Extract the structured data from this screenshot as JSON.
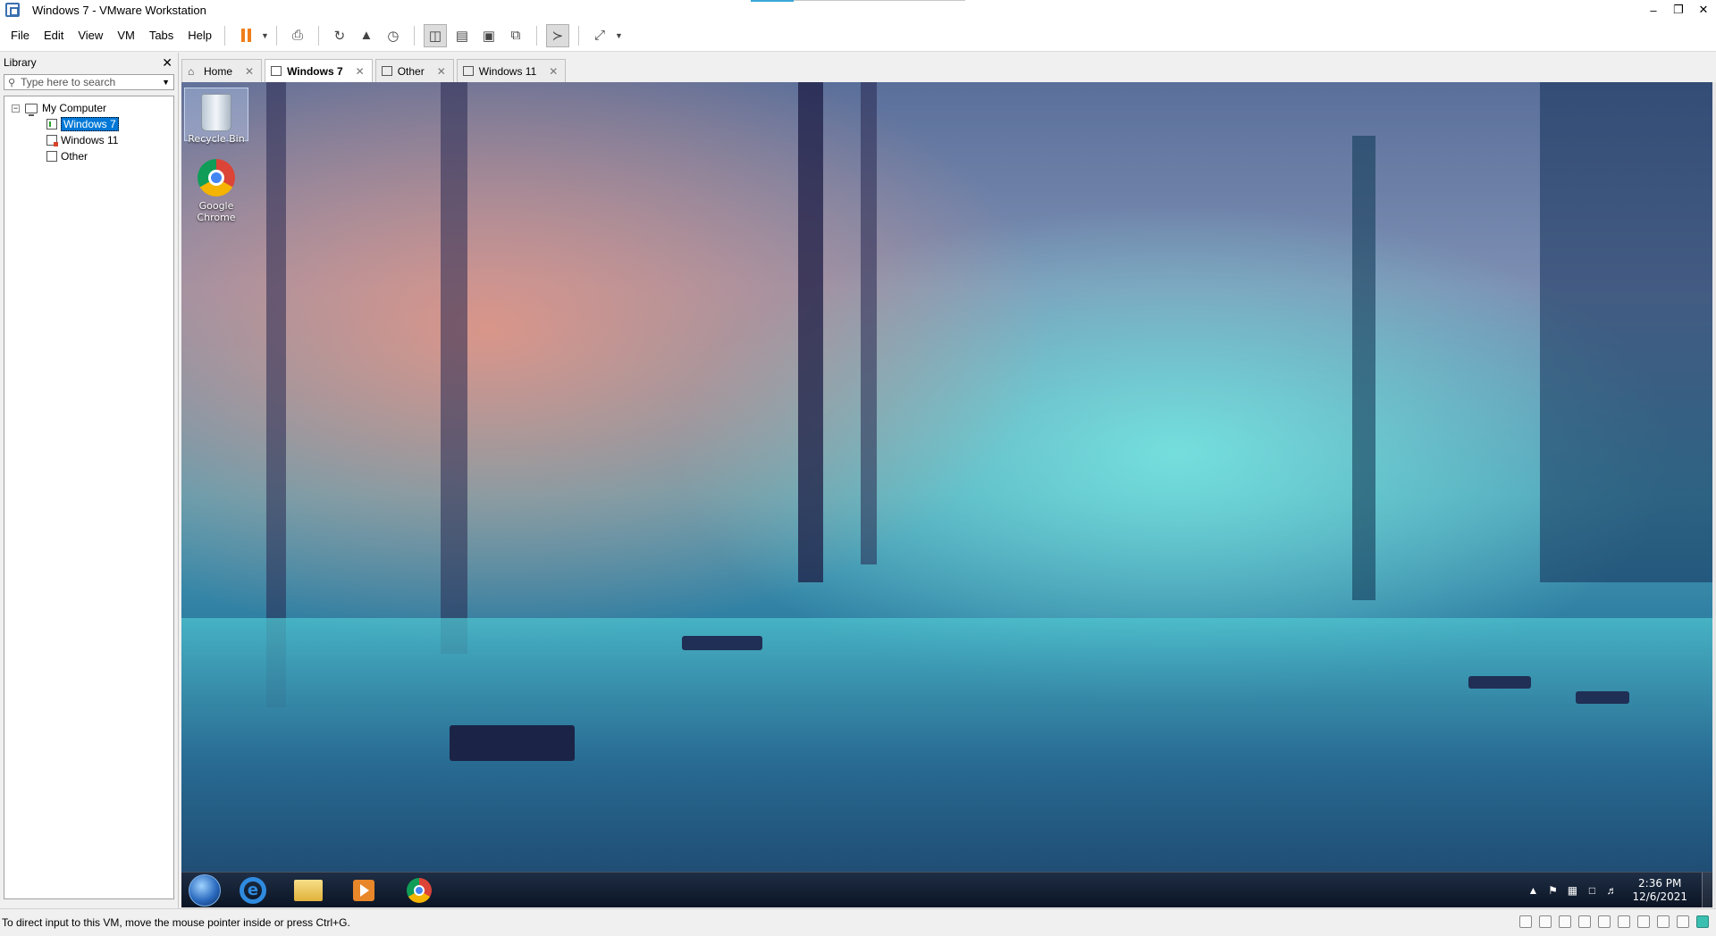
{
  "window": {
    "title": "Windows 7 - VMware Workstation"
  },
  "menu": {
    "items": [
      "File",
      "Edit",
      "View",
      "VM",
      "Tabs",
      "Help"
    ]
  },
  "toolbar": {
    "buttons": [
      "pause",
      "send-ctrl-alt-del",
      "snapshot",
      "revert-snapshot",
      "snapshot-manager",
      "show-library",
      "thumbnail-bar",
      "full-screen",
      "unity",
      "console-view",
      "stretch-guest"
    ]
  },
  "library": {
    "title": "Library",
    "search_placeholder": "Type here to search",
    "tree": {
      "root": "My Computer",
      "children": [
        {
          "label": "Windows 7",
          "selected": true
        },
        {
          "label": "Windows 11",
          "selected": false
        },
        {
          "label": "Other",
          "selected": false
        }
      ]
    }
  },
  "tabs": [
    {
      "label": "Home",
      "active": false
    },
    {
      "label": "Windows 7",
      "active": true
    },
    {
      "label": "Other",
      "active": false
    },
    {
      "label": "Windows 11",
      "active": false
    }
  ],
  "guest": {
    "desktop_icons": [
      {
        "label": "Recycle Bin",
        "icon": "recycle-bin-icon"
      },
      {
        "label": "Google Chrome",
        "icon": "chrome-icon"
      }
    ],
    "taskbar": {
      "apps": [
        "internet-explorer",
        "windows-explorer",
        "media-player",
        "google-chrome"
      ],
      "clock_time": "2:36 PM",
      "clock_date": "12/6/2021"
    }
  },
  "statusbar": {
    "message": "To direct input to this VM, move the mouse pointer inside or press Ctrl+G."
  },
  "colors": {
    "accent": "#0078d7",
    "pause": "#f07d1a"
  }
}
